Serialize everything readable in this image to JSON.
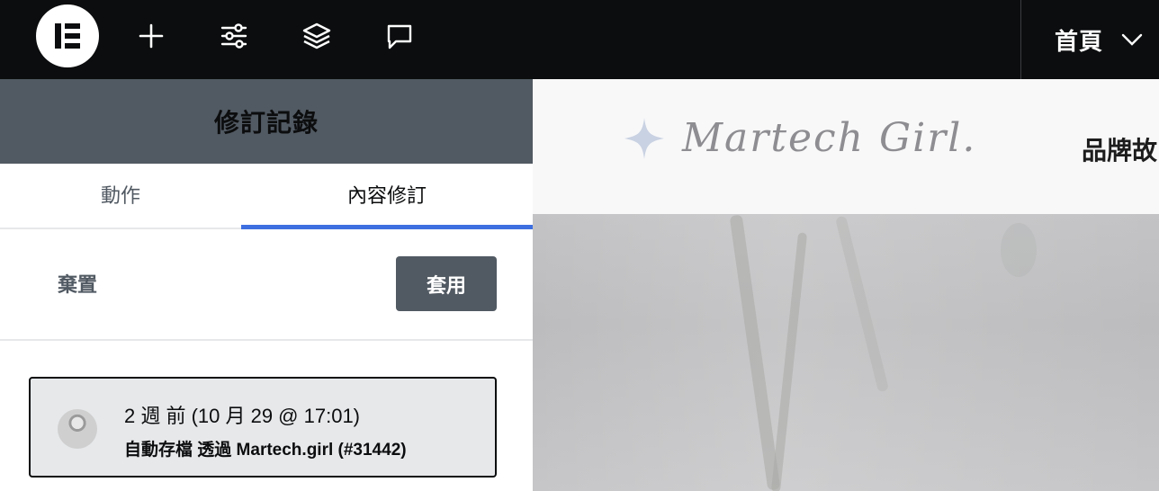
{
  "topbar": {
    "icons": [
      "elementor-logo-icon",
      "plus-icon",
      "sliders-icon",
      "layers-icon",
      "comment-icon"
    ],
    "page_selector": {
      "label": "首頁",
      "icon": "chevron-down-icon"
    }
  },
  "panel": {
    "title": "修訂記錄",
    "tabs": [
      {
        "label": "動作",
        "active": false
      },
      {
        "label": "內容修訂",
        "active": true
      }
    ],
    "discard_label": "棄置",
    "apply_label": "套用",
    "revisions": [
      {
        "date": "2 週 前 (10 月 29 @ 17:01)",
        "meta": "自動存檔 透過 Martech.girl (#31442)",
        "avatar": "user-avatar"
      }
    ]
  },
  "preview": {
    "logo_text": "Martech Girl.",
    "nav_item": "品牌故"
  },
  "colors": {
    "topbar_bg": "#0c0d0e",
    "panel_header_bg": "#515962",
    "tab_active_underline": "#3e6fe0",
    "apply_button_bg": "#515962",
    "revision_bg": "#e6e8ea"
  }
}
